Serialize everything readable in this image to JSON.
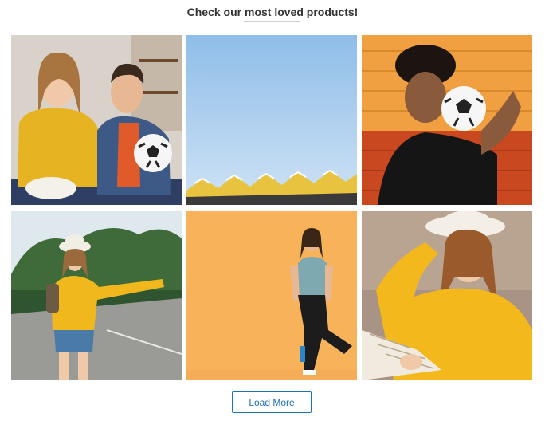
{
  "header": {
    "title": "Check our most loved products!"
  },
  "products": [
    {
      "image": "couple-watching-football-photo"
    },
    {
      "image": "blue-sky-cube-houses-photo"
    },
    {
      "image": "man-holding-football-orange-wall-photo"
    },
    {
      "image": "girl-hitchhiking-road-photo"
    },
    {
      "image": "woman-fitness-orange-background-photo"
    },
    {
      "image": "girl-reading-map-yellow-sweater-photo"
    }
  ],
  "actions": {
    "load_more": "Load More"
  },
  "colors": {
    "accent": "#1e6fb5",
    "title": "#333333"
  }
}
